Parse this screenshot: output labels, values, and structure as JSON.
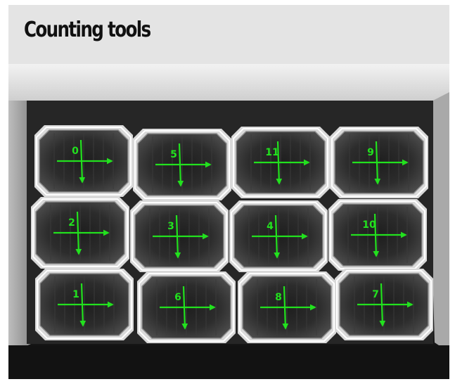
{
  "header": {
    "title": "Counting tools"
  },
  "viewer": {
    "overlay_color": "#22e11e",
    "cells": [
      {
        "label": "0"
      },
      {
        "label": "5"
      },
      {
        "label": "11"
      },
      {
        "label": "9"
      },
      {
        "label": "2"
      },
      {
        "label": "3"
      },
      {
        "label": "4"
      },
      {
        "label": "10"
      },
      {
        "label": "1"
      },
      {
        "label": "6"
      },
      {
        "label": "8"
      },
      {
        "label": "7"
      }
    ]
  }
}
